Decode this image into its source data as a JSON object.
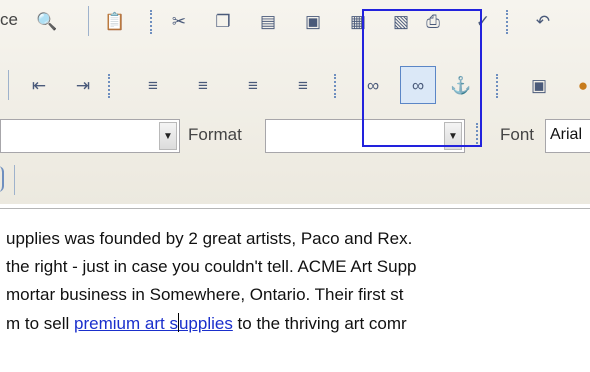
{
  "toolbar": {
    "row1": {
      "partial_label": "ce",
      "icons": [
        "preview-icon",
        "paste-text-icon",
        "cut-icon",
        "copy-icon",
        "paste-icon",
        "paste-word-icon",
        "paste-plain-icon",
        "print-icon",
        "spellcheck-icon",
        "undo-icon"
      ]
    },
    "row2": {
      "icons": [
        "outdent-icon",
        "indent-icon",
        "align-left-icon",
        "align-center-icon",
        "align-right-icon",
        "justify-icon",
        "link-icon",
        "unlink-icon",
        "anchor-icon",
        "image-icon",
        "flash-icon"
      ],
      "selected": "unlink-icon"
    },
    "row3": {
      "style_value": "",
      "format_label": "Format",
      "format_value": "",
      "font_label": "Font",
      "font_value": "Arial"
    }
  },
  "editor": {
    "lines": [
      "upplies was founded by 2 great artists, Paco and Rex.",
      "the right - just in case you couldn't tell.  ACME Art Supp",
      "mortar business in Somewhere, Ontario.  Their first st"
    ],
    "line4_prefix": "m to sell ",
    "link_text_a": "premium art s",
    "link_text_b": "upplies",
    "line4_suffix": " to the thriving art comr"
  },
  "colors": {
    "highlight_box": "#2222dd",
    "selected_button_bg": "#dbe8f7",
    "link": "#1a2fcc"
  }
}
